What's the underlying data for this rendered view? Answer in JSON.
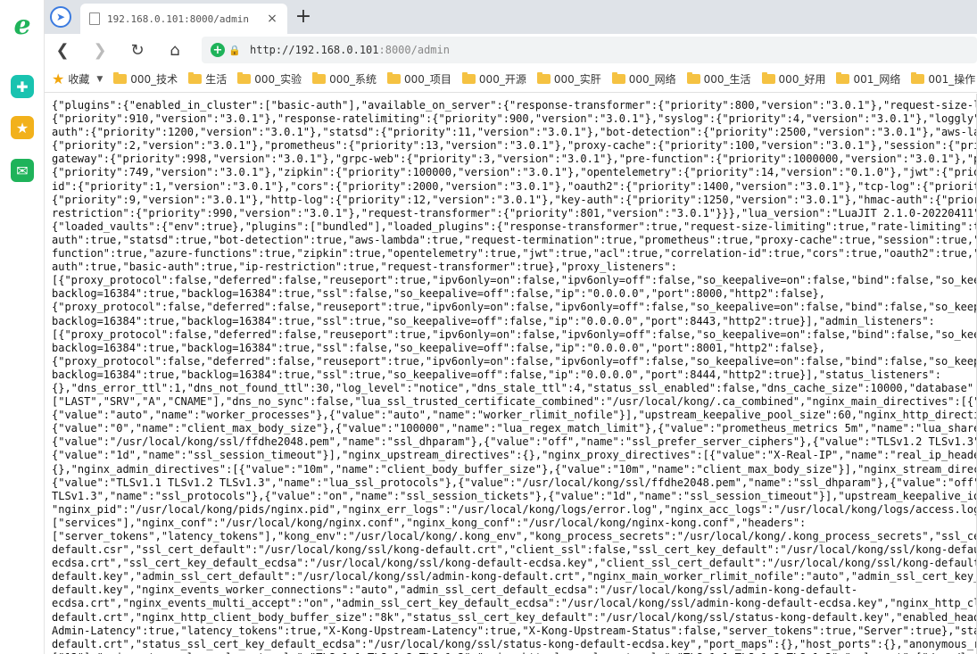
{
  "browser": {
    "tab_title": "192.168.0.101:8000/admin",
    "tab_close": "×",
    "new_tab": "+",
    "url_host": "http://192.168.0.101",
    "url_rest": ":8000/admin",
    "icons": {
      "logo": "e",
      "nav": "➤",
      "back": "❮",
      "forward": "❯",
      "reload": "↻",
      "home": "⌂"
    }
  },
  "bookmarks": [
    {
      "label": "收藏",
      "type": "favorites"
    },
    {
      "label": "000_技术",
      "type": "folder"
    },
    {
      "label": "生活",
      "type": "folder"
    },
    {
      "label": "000_实验",
      "type": "folder"
    },
    {
      "label": "000_系统",
      "type": "folder"
    },
    {
      "label": "000_项目",
      "type": "folder"
    },
    {
      "label": "000_开源",
      "type": "folder"
    },
    {
      "label": "000_实肝",
      "type": "folder"
    },
    {
      "label": "000_网络",
      "type": "folder"
    },
    {
      "label": "000_生活",
      "type": "folder"
    },
    {
      "label": "000_好用",
      "type": "folder"
    },
    {
      "label": "001_网络",
      "type": "folder"
    },
    {
      "label": "001_操作",
      "type": "folder"
    }
  ],
  "json_lines": [
    "{\"plugins\":{\"enabled_in_cluster\":[\"basic-auth\"],\"available_on_server\":{\"response-transformer\":{\"priority\":800,\"version\":\"3.0.1\"},\"request-size-limiting\":",
    "{\"priority\":910,\"version\":\"3.0.1\"},\"response-ratelimiting\":{\"priority\":900,\"version\":\"3.0.1\"},\"syslog\":{\"priority\":4,\"version\":\"3.0.1\"},\"loggly\":{\"prio",
    "auth\":{\"priority\":1200,\"version\":\"3.0.1\"},\"statsd\":{\"priority\":11,\"version\":\"3.0.1\"},\"bot-detection\":{\"priority\":2500,\"version\":\"3.0.1\"},\"aws-lambda\":",
    "{\"priority\":2,\"version\":\"3.0.1\"},\"prometheus\":{\"priority\":13,\"version\":\"3.0.1\"},\"proxy-cache\":{\"priority\":100,\"version\":\"3.0.1\"},\"session\":{\"priority\"",
    "gateway\":{\"priority\":998,\"version\":\"3.0.1\"},\"grpc-web\":{\"priority\":3,\"version\":\"3.0.1\"},\"pre-function\":{\"priority\":1000000,\"version\":\"3.0.1\"},\"post-fun",
    "{\"priority\":749,\"version\":\"3.0.1\"},\"zipkin\":{\"priority\":100000,\"version\":\"3.0.1\"},\"opentelemetry\":{\"priority\":14,\"version\":\"0.1.0\"},\"jwt\":{\"priority\":",
    "id\":{\"priority\":1,\"version\":\"3.0.1\"},\"cors\":{\"priority\":2000,\"version\":\"3.0.1\"},\"oauth2\":{\"priority\":1400,\"version\":\"3.0.1\"},\"tcp-log\":{\"priority\":7,\"v",
    "{\"priority\":9,\"version\":\"3.0.1\"},\"http-log\":{\"priority\":12,\"version\":\"3.0.1\"},\"key-auth\":{\"priority\":1250,\"version\":\"3.0.1\"},\"hmac-auth\":{\"priority\":",
    "restriction\":{\"priority\":990,\"version\":\"3.0.1\"},\"request-transformer\":{\"priority\":801,\"version\":\"3.0.1\"}}},\"lua_version\":\"LuaJIT 2.1.0-20220411\",\"pid\":",
    "{\"loaded_vaults\":{\"env\":true},\"plugins\":[\"bundled\"],\"loaded_plugins\":{\"response-transformer\":true,\"request-size-limiting\":true,\"rate-limiting\":true,\"resp",
    "auth\":true,\"statsd\":true,\"bot-detection\":true,\"aws-lambda\":true,\"request-termination\":true,\"prometheus\":true,\"proxy-cache\":true,\"session\":true,\"acme\":tr",
    "function\":true,\"azure-functions\":true,\"zipkin\":true,\"opentelemetry\":true,\"jwt\":true,\"acl\":true,\"correlation-id\":true,\"cors\":true,\"oauth2\":true,\"tcp-log\"",
    "auth\":true,\"basic-auth\":true,\"ip-restriction\":true,\"request-transformer\":true},\"proxy_listeners\":",
    "[{\"proxy_protocol\":false,\"deferred\":false,\"reuseport\":true,\"ipv6only=on\":false,\"ipv6only=off\":false,\"so_keepalive=on\":false,\"bind\":false,\"so_keepalive",
    "backlog=16384\":true,\"backlog=16384\":true,\"ssl\":false,\"so_keepalive=off\":false,\"ip\":\"0.0.0.0\",\"port\":8000,\"http2\":false},",
    "{\"proxy_protocol\":false,\"deferred\":false,\"reuseport\":true,\"ipv6only=on\":false,\"ipv6only=off\":false,\"so_keepalive=on\":false,\"bind\":false,\"so_keepalive",
    "backlog=16384\":true,\"backlog=16384\":true,\"ssl\":true,\"so_keepalive=off\":false,\"ip\":\"0.0.0.0\",\"port\":8443,\"http2\":true}],\"admin_listeners\":",
    "[{\"proxy_protocol\":false,\"deferred\":false,\"reuseport\":true,\"ipv6only=on\":false,\"ipv6only=off\":false,\"so_keepalive=on\":false,\"bind\":false,\"so_keepalive",
    "backlog=16384\":true,\"backlog=16384\":true,\"ssl\":false,\"so_keepalive=off\":false,\"ip\":\"0.0.0.0\",\"port\":8001,\"http2\":false},",
    "{\"proxy_protocol\":false,\"deferred\":false,\"reuseport\":true,\"ipv6only=on\":false,\"ipv6only=off\":false,\"so_keepalive=on\":false,\"bind\":false,\"so_keepalive",
    "backlog=16384\":true,\"backlog=16384\":true,\"ssl\":true,\"so_keepalive=off\":false,\"ip\":\"0.0.0.0\",\"port\":8444,\"http2\":true}],\"status_listeners\":",
    "{},\"dns_error_ttl\":1,\"dns_not_found_ttl\":30,\"log_level\":\"notice\",\"dns_stale_ttl\":4,\"status_ssl_enabled\":false,\"dns_cache_size\":10000,\"database\":\"postg",
    "[\"LAST\",\"SRV\",\"A\",\"CNAME\"],\"dns_no_sync\":false,\"lua_ssl_trusted_certificate_combined\":\"/usr/local/kong/.ca_combined\",\"nginx_main_directives\":[{\"value\":",
    "{\"value\":\"auto\",\"name\":\"worker_processes\"},{\"value\":\"auto\",\"name\":\"worker_rlimit_nofile\"}],\"upstream_keepalive_pool_size\":60,\"nginx_http_directives\":[{",
    "{\"value\":\"0\",\"name\":\"client_max_body_size\"},{\"value\":\"100000\",\"name\":\"lua_regex_match_limit\"},{\"value\":\"prometheus_metrics 5m\",\"name\":\"lua_shared_dict\"",
    "{\"value\":\"/usr/local/kong/ssl/ffdhe2048.pem\",\"name\":\"ssl_dhparam\"},{\"value\":\"off\",\"name\":\"ssl_prefer_server_ciphers\"},{\"value\":\"TLSv1.2 TLSv1.3\",\"name",
    "{\"value\":\"1d\",\"name\":\"ssl_session_timeout\"}],\"nginx_upstream_directives\":{},\"nginx_proxy_directives\":[{\"value\":\"X-Real-IP\",\"name\":\"real_ip_header\"},{\"",
    "{},\"nginx_admin_directives\":[{\"value\":\"10m\",\"name\":\"client_body_buffer_size\"},{\"value\":\"10m\",\"name\":\"client_max_body_size\"}],\"nginx_stream_directives\":",
    "{\"value\":\"TLSv1.1 TLSv1.2 TLSv1.3\",\"name\":\"lua_ssl_protocols\"},{\"value\":\"/usr/local/kong/ssl/ffdhe2048.pem\",\"name\":\"ssl_dhparam\"},{\"value\":\"off\",\"na",
    "TLSv1.3\",\"name\":\"ssl_protocols\"},{\"value\":\"on\",\"name\":\"ssl_session_tickets\"},{\"value\":\"1d\",\"name\":\"ssl_session_timeout\"}],\"upstream_keepalive_idle_time",
    "\"nginx_pid\":\"/usr/local/kong/pids/nginx.pid\",\"nginx_err_logs\":\"/usr/local/kong/logs/error.log\",\"nginx_acc_logs\":\"/usr/local/kong/logs/access.log\",\"admi",
    "[\"services\"],\"nginx_conf\":\"/usr/local/kong/nginx.conf\",\"nginx_kong_conf\":\"/usr/local/kong/nginx-kong.conf\",\"headers\":",
    "[\"server_tokens\",\"latency_tokens\"],\"kong_env\":\"/usr/local/kong/.kong_env\",\"kong_process_secrets\":\"/usr/local/kong/.kong_process_secrets\",\"ssl_cert_csr_",
    "default.csr\",\"ssl_cert_default\":\"/usr/local/kong/ssl/kong-default.crt\",\"client_ssl\":false,\"ssl_cert_key_default\":\"/usr/local/kong/ssl/kong-default.key\",\"ss",
    "ecdsa.crt\",\"ssl_cert_key_default_ecdsa\":\"/usr/local/kong/ssl/kong-default-ecdsa.key\",\"client_ssl_cert_default\":\"/usr/local/kong/ssl/kong-default.crt\",\"clien",
    "default.key\",\"admin_ssl_cert_default\":\"/usr/local/kong/ssl/admin-kong-default.crt\",\"nginx_main_worker_rlimit_nofile\":\"auto\",\"admin_ssl_cert_key_default\":\"/u",
    "default.key\",\"nginx_events_worker_connections\":\"auto\",\"admin_ssl_cert_default_ecdsa\":\"/usr/local/kong/ssl/admin-kong-default-",
    "ecdsa.crt\",\"nginx_events_multi_accept\":\"on\",\"admin_ssl_cert_key_default_ecdsa\":\"/usr/local/kong/ssl/admin-kong-default-ecdsa.key\",\"nginx_http_client_max_b",
    "default.crt\",\"nginx_http_client_body_buffer_size\":\"8k\",\"status_ssl_cert_key_default\":\"/usr/local/kong/ssl/status-kong-default.key\",\"enabled_headers\":",
    "Admin-Latency\":true,\"latency_tokens\":true,\"X-Kong-Upstream-Latency\":true,\"X-Kong-Upstream-Status\":false,\"server_tokens\":true,\"Server\":true},\"status_acces",
    "default.crt\",\"status_ssl_cert_key_default_ecdsa\":\"/usr/local/kong/ssl/status-kong-default-ecdsa.key\",\"port_maps\":{},\"host_ports\":{},\"anonymous_reports\":tr",
    "[\"12\"],\"nginx_stream_lua_ssl_protocols\":\"TLSv1.1 TLSv1.2 TLSv1.3\",\"nginx_http_lua_ssl_protocols\":\"TLSv1.1 TLSv1.2 TLSv1.3\",\"ssl_cert\":[\"/usr/local/kong/"
  ]
}
